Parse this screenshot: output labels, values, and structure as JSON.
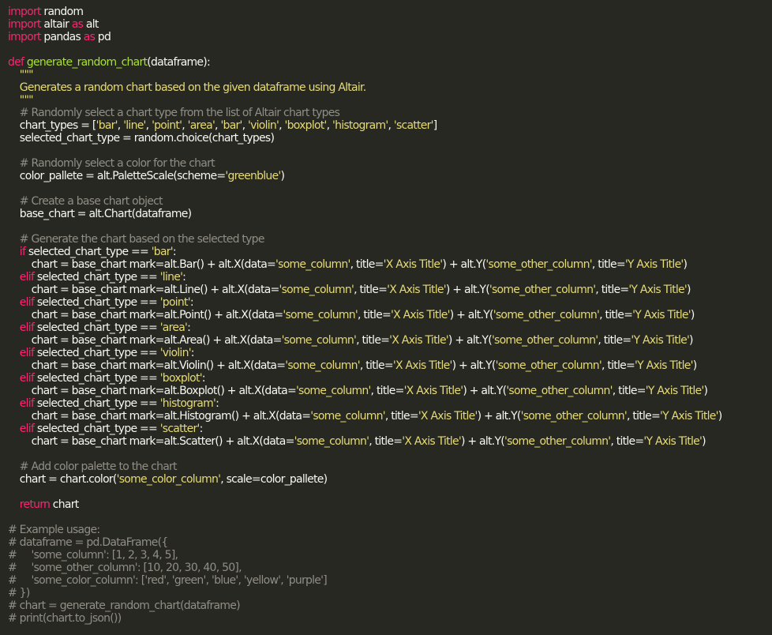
{
  "editor": {
    "theme_colors": {
      "background": "#272822",
      "text": "#f8f8f2",
      "keyword": "#f92672",
      "string": "#e6db74",
      "function_name": "#a6e22e",
      "comment": "#908e85"
    },
    "lines": [
      [
        [
          "kw",
          "import"
        ],
        [
          "p",
          " random"
        ]
      ],
      [
        [
          "kw",
          "import"
        ],
        [
          "p",
          " altair "
        ],
        [
          "kw",
          "as"
        ],
        [
          "p",
          " alt"
        ]
      ],
      [
        [
          "kw",
          "import"
        ],
        [
          "p",
          " pandas "
        ],
        [
          "kw",
          "as"
        ],
        [
          "p",
          " pd"
        ]
      ],
      [],
      [
        [
          "kw",
          "def"
        ],
        [
          "p",
          " "
        ],
        [
          "fn",
          "generate_random_chart"
        ],
        [
          "p",
          "(dataframe):"
        ]
      ],
      [
        [
          "s",
          "    \"\"\""
        ]
      ],
      [
        [
          "s",
          "    Generates a random chart based on the given dataframe using Altair."
        ]
      ],
      [
        [
          "s",
          "    \"\"\""
        ]
      ],
      [
        [
          "c",
          "    # Randomly select a chart type from the list of Altair chart types"
        ]
      ],
      [
        [
          "p",
          "    chart_types = ["
        ],
        [
          "s",
          "'bar'"
        ],
        [
          "p",
          ", "
        ],
        [
          "s",
          "'line'"
        ],
        [
          "p",
          ", "
        ],
        [
          "s",
          "'point'"
        ],
        [
          "p",
          ", "
        ],
        [
          "s",
          "'area'"
        ],
        [
          "p",
          ", "
        ],
        [
          "s",
          "'bar'"
        ],
        [
          "p",
          ", "
        ],
        [
          "s",
          "'violin'"
        ],
        [
          "p",
          ", "
        ],
        [
          "s",
          "'boxplot'"
        ],
        [
          "p",
          ", "
        ],
        [
          "s",
          "'histogram'"
        ],
        [
          "p",
          ", "
        ],
        [
          "s",
          "'scatter'"
        ],
        [
          "p",
          "]"
        ]
      ],
      [
        [
          "p",
          "    selected_chart_type = random.choice(chart_types)"
        ]
      ],
      [],
      [
        [
          "c",
          "    # Randomly select a color for the chart"
        ]
      ],
      [
        [
          "p",
          "    color_pallete = alt.PaletteScale(scheme="
        ],
        [
          "s",
          "'greenblue'"
        ],
        [
          "p",
          ")"
        ]
      ],
      [],
      [
        [
          "c",
          "    # Create a base chart object"
        ]
      ],
      [
        [
          "p",
          "    base_chart = alt.Chart(dataframe)"
        ]
      ],
      [],
      [
        [
          "c",
          "    # Generate the chart based on the selected type"
        ]
      ],
      [
        [
          "kw",
          "    if"
        ],
        [
          "p",
          " selected_chart_type == "
        ],
        [
          "s",
          "'bar'"
        ],
        [
          "p",
          ":"
        ]
      ],
      [
        [
          "p",
          "        chart = base_chart mark=alt.Bar() + alt.X(data="
        ],
        [
          "s",
          "'some_column'"
        ],
        [
          "p",
          ", title="
        ],
        [
          "s",
          "'X Axis Title'"
        ],
        [
          "p",
          ") + alt.Y("
        ],
        [
          "s",
          "'some_other_column'"
        ],
        [
          "p",
          ", title="
        ],
        [
          "s",
          "'Y Axis Title'"
        ],
        [
          "p",
          ")"
        ]
      ],
      [
        [
          "kw",
          "    elif"
        ],
        [
          "p",
          " selected_chart_type == "
        ],
        [
          "s",
          "'line'"
        ],
        [
          "p",
          ":"
        ]
      ],
      [
        [
          "p",
          "        chart = base_chart mark=alt.Line() + alt.X(data="
        ],
        [
          "s",
          "'some_column'"
        ],
        [
          "p",
          ", title="
        ],
        [
          "s",
          "'X Axis Title'"
        ],
        [
          "p",
          ") + alt.Y("
        ],
        [
          "s",
          "'some_other_column'"
        ],
        [
          "p",
          ", title="
        ],
        [
          "s",
          "'Y Axis Title'"
        ],
        [
          "p",
          ")"
        ]
      ],
      [
        [
          "kw",
          "    elif"
        ],
        [
          "p",
          " selected_chart_type == "
        ],
        [
          "s",
          "'point'"
        ],
        [
          "p",
          ":"
        ]
      ],
      [
        [
          "p",
          "        chart = base_chart mark=alt.Point() + alt.X(data="
        ],
        [
          "s",
          "'some_column'"
        ],
        [
          "p",
          ", title="
        ],
        [
          "s",
          "'X Axis Title'"
        ],
        [
          "p",
          ") + alt.Y("
        ],
        [
          "s",
          "'some_other_column'"
        ],
        [
          "p",
          ", title="
        ],
        [
          "s",
          "'Y Axis Title'"
        ],
        [
          "p",
          ")"
        ]
      ],
      [
        [
          "kw",
          "    elif"
        ],
        [
          "p",
          " selected_chart_type == "
        ],
        [
          "s",
          "'area'"
        ],
        [
          "p",
          ":"
        ]
      ],
      [
        [
          "p",
          "        chart = base_chart mark=alt.Area() + alt.X(data="
        ],
        [
          "s",
          "'some_column'"
        ],
        [
          "p",
          ", title="
        ],
        [
          "s",
          "'X Axis Title'"
        ],
        [
          "p",
          ") + alt.Y("
        ],
        [
          "s",
          "'some_other_column'"
        ],
        [
          "p",
          ", title="
        ],
        [
          "s",
          "'Y Axis Title'"
        ],
        [
          "p",
          ")"
        ]
      ],
      [
        [
          "kw",
          "    elif"
        ],
        [
          "p",
          " selected_chart_type == "
        ],
        [
          "s",
          "'violin'"
        ],
        [
          "p",
          ":"
        ]
      ],
      [
        [
          "p",
          "        chart = base_chart mark=alt.Violin() + alt.X(data="
        ],
        [
          "s",
          "'some_column'"
        ],
        [
          "p",
          ", title="
        ],
        [
          "s",
          "'X Axis Title'"
        ],
        [
          "p",
          ") + alt.Y("
        ],
        [
          "s",
          "'some_other_column'"
        ],
        [
          "p",
          ", title="
        ],
        [
          "s",
          "'Y Axis Title'"
        ],
        [
          "p",
          ")"
        ]
      ],
      [
        [
          "kw",
          "    elif"
        ],
        [
          "p",
          " selected_chart_type == "
        ],
        [
          "s",
          "'boxplot'"
        ],
        [
          "p",
          ":"
        ]
      ],
      [
        [
          "p",
          "        chart = base_chart mark=alt.Boxplot() + alt.X(data="
        ],
        [
          "s",
          "'some_column'"
        ],
        [
          "p",
          ", title="
        ],
        [
          "s",
          "'X Axis Title'"
        ],
        [
          "p",
          ") + alt.Y("
        ],
        [
          "s",
          "'some_other_column'"
        ],
        [
          "p",
          ", title="
        ],
        [
          "s",
          "'Y Axis Title'"
        ],
        [
          "p",
          ")"
        ]
      ],
      [
        [
          "kw",
          "    elif"
        ],
        [
          "p",
          " selected_chart_type == "
        ],
        [
          "s",
          "'histogram'"
        ],
        [
          "p",
          ":"
        ]
      ],
      [
        [
          "p",
          "        chart = base_chart mark=alt.Histogram() + alt.X(data="
        ],
        [
          "s",
          "'some_column'"
        ],
        [
          "p",
          ", title="
        ],
        [
          "s",
          "'X Axis Title'"
        ],
        [
          "p",
          ") + alt.Y("
        ],
        [
          "s",
          "'some_other_column'"
        ],
        [
          "p",
          ", title="
        ],
        [
          "s",
          "'Y Axis Title'"
        ],
        [
          "p",
          ")"
        ]
      ],
      [
        [
          "kw",
          "    elif"
        ],
        [
          "p",
          " selected_chart_type == "
        ],
        [
          "s",
          "'scatter'"
        ],
        [
          "p",
          ":"
        ]
      ],
      [
        [
          "p",
          "        chart = base_chart mark=alt.Scatter() + alt.X(data="
        ],
        [
          "s",
          "'some_column'"
        ],
        [
          "p",
          ", title="
        ],
        [
          "s",
          "'X Axis Title'"
        ],
        [
          "p",
          ") + alt.Y("
        ],
        [
          "s",
          "'some_other_column'"
        ],
        [
          "p",
          ", title="
        ],
        [
          "s",
          "'Y Axis Title'"
        ],
        [
          "p",
          ")"
        ]
      ],
      [],
      [
        [
          "c",
          "    # Add color palette to the chart"
        ]
      ],
      [
        [
          "p",
          "    chart = chart.color("
        ],
        [
          "s",
          "'some_color_column'"
        ],
        [
          "p",
          ", scale=color_pallete)"
        ]
      ],
      [],
      [
        [
          "kw",
          "    return"
        ],
        [
          "p",
          " chart"
        ]
      ],
      [],
      [
        [
          "c",
          "# Example usage:"
        ]
      ],
      [
        [
          "c",
          "# dataframe = pd.DataFrame({"
        ]
      ],
      [
        [
          "c",
          "#     'some_column': [1, 2, 3, 4, 5],"
        ]
      ],
      [
        [
          "c",
          "#     'some_other_column': [10, 20, 30, 40, 50],"
        ]
      ],
      [
        [
          "c",
          "#     'some_color_column': ['red', 'green', 'blue', 'yellow', 'purple']"
        ]
      ],
      [
        [
          "c",
          "# })"
        ]
      ],
      [
        [
          "c",
          "# chart = generate_random_chart(dataframe)"
        ]
      ],
      [
        [
          "c",
          "# print(chart.to_json())"
        ]
      ]
    ]
  }
}
